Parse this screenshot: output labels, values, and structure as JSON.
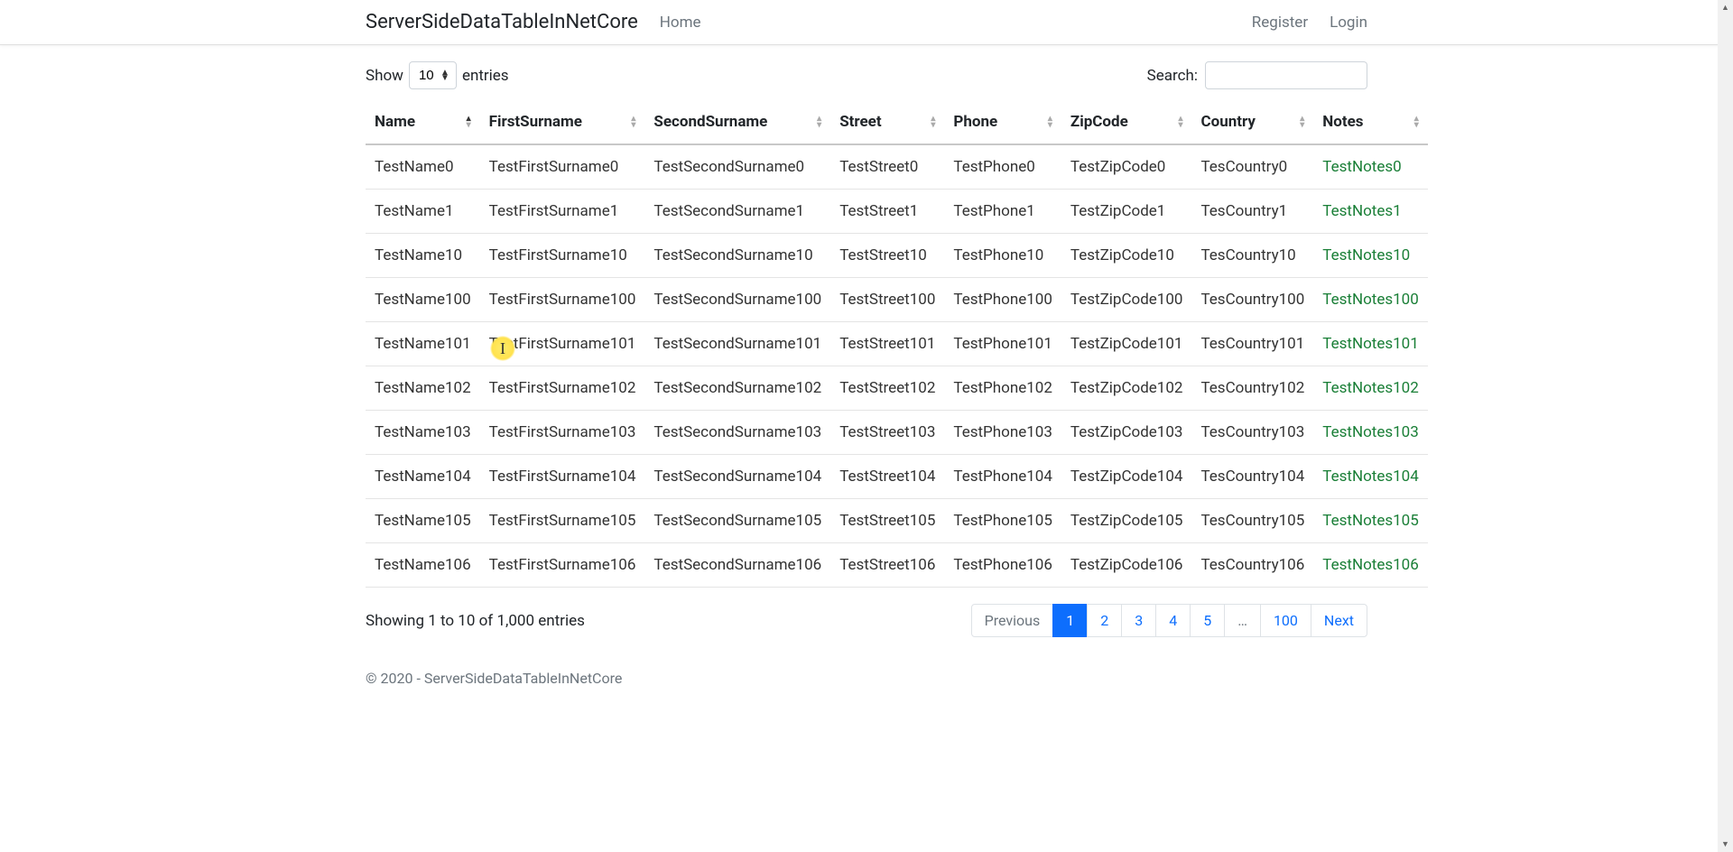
{
  "nav": {
    "brand": "ServerSideDataTableInNetCore",
    "home": "Home",
    "register": "Register",
    "login": "Login"
  },
  "lengthMenu": {
    "show": "Show",
    "entries": "entries",
    "value": "10"
  },
  "search": {
    "label": "Search:",
    "value": ""
  },
  "columns": [
    "Name",
    "FirstSurname",
    "SecondSurname",
    "Street",
    "Phone",
    "ZipCode",
    "Country",
    "Notes"
  ],
  "rows": [
    {
      "name": "TestName0",
      "fs": "TestFirstSurname0",
      "ss": "TestSecondSurname0",
      "st": "TestStreet0",
      "ph": "TestPhone0",
      "zip": "TestZipCode0",
      "co": "TesCountry0",
      "no": "TestNotes0"
    },
    {
      "name": "TestName1",
      "fs": "TestFirstSurname1",
      "ss": "TestSecondSurname1",
      "st": "TestStreet1",
      "ph": "TestPhone1",
      "zip": "TestZipCode1",
      "co": "TesCountry1",
      "no": "TestNotes1"
    },
    {
      "name": "TestName10",
      "fs": "TestFirstSurname10",
      "ss": "TestSecondSurname10",
      "st": "TestStreet10",
      "ph": "TestPhone10",
      "zip": "TestZipCode10",
      "co": "TesCountry10",
      "no": "TestNotes10"
    },
    {
      "name": "TestName100",
      "fs": "TestFirstSurname100",
      "ss": "TestSecondSurname100",
      "st": "TestStreet100",
      "ph": "TestPhone100",
      "zip": "TestZipCode100",
      "co": "TesCountry100",
      "no": "TestNotes100"
    },
    {
      "name": "TestName101",
      "fs": "TestFirstSurname101",
      "ss": "TestSecondSurname101",
      "st": "TestStreet101",
      "ph": "TestPhone101",
      "zip": "TestZipCode101",
      "co": "TesCountry101",
      "no": "TestNotes101"
    },
    {
      "name": "TestName102",
      "fs": "TestFirstSurname102",
      "ss": "TestSecondSurname102",
      "st": "TestStreet102",
      "ph": "TestPhone102",
      "zip": "TestZipCode102",
      "co": "TesCountry102",
      "no": "TestNotes102"
    },
    {
      "name": "TestName103",
      "fs": "TestFirstSurname103",
      "ss": "TestSecondSurname103",
      "st": "TestStreet103",
      "ph": "TestPhone103",
      "zip": "TestZipCode103",
      "co": "TesCountry103",
      "no": "TestNotes103"
    },
    {
      "name": "TestName104",
      "fs": "TestFirstSurname104",
      "ss": "TestSecondSurname104",
      "st": "TestStreet104",
      "ph": "TestPhone104",
      "zip": "TestZipCode104",
      "co": "TesCountry104",
      "no": "TestNotes104"
    },
    {
      "name": "TestName105",
      "fs": "TestFirstSurname105",
      "ss": "TestSecondSurname105",
      "st": "TestStreet105",
      "ph": "TestPhone105",
      "zip": "TestZipCode105",
      "co": "TesCountry105",
      "no": "TestNotes105"
    },
    {
      "name": "TestName106",
      "fs": "TestFirstSurname106",
      "ss": "TestSecondSurname106",
      "st": "TestStreet106",
      "ph": "TestPhone106",
      "zip": "TestZipCode106",
      "co": "TesCountry106",
      "no": "TestNotes106"
    }
  ],
  "info": "Showing 1 to 10 of 1,000 entries",
  "pagination": {
    "previous": "Previous",
    "pages": [
      "1",
      "2",
      "3",
      "4",
      "5"
    ],
    "ellipsis": "…",
    "last": "100",
    "next": "Next",
    "active": "1"
  },
  "footer": "© 2020 - ServerSideDataTableInNetCore"
}
